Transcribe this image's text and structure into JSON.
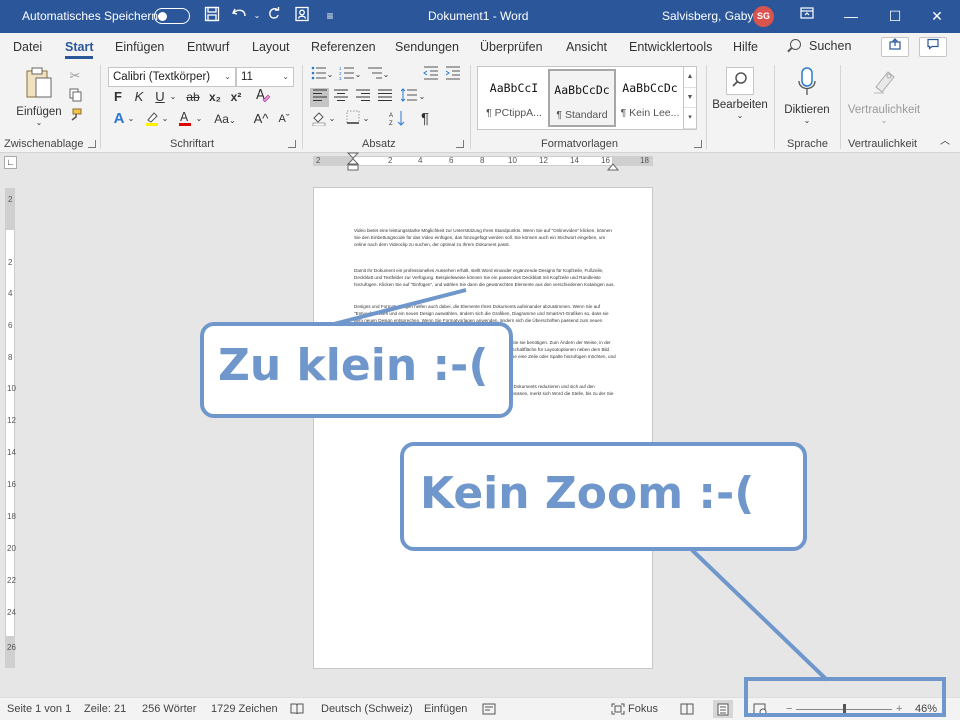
{
  "titlebar": {
    "autosave_label": "Automatisches Speichern",
    "doc_title": "Dokument1  -  Word",
    "user_name": "Salvisberg, Gaby",
    "user_initials": "SG"
  },
  "tabs": [
    "Datei",
    "Start",
    "Einfügen",
    "Entwurf",
    "Layout",
    "Referenzen",
    "Sendungen",
    "Überprüfen",
    "Ansicht",
    "Entwicklertools",
    "Hilfe"
  ],
  "active_tab": "Start",
  "search_label": "Suchen",
  "ribbon": {
    "clipboard": {
      "paste_label": "Einfügen",
      "group_label": "Zwischenablage"
    },
    "font": {
      "font_name": "Calibri (Textkörper)",
      "font_size": "11",
      "group_label": "Schriftart",
      "bold": "F",
      "italic": "K",
      "underline": "U",
      "strike": "ab",
      "sub": "x₂",
      "sup": "x²",
      "case": "Aa",
      "grow": "A^",
      "shrink": "Aˇ"
    },
    "paragraph": {
      "group_label": "Absatz"
    },
    "styles": {
      "group_label": "Formatvorlagen",
      "items": [
        {
          "sample": "AaBbCcI",
          "name": "¶ PCtippA..."
        },
        {
          "sample": "AaBbCcDc",
          "name": "¶ Standard"
        },
        {
          "sample": "AaBbCcDc",
          "name": "¶ Kein Lee..."
        }
      ]
    },
    "editing": {
      "label": "Bearbeiten"
    },
    "voice": {
      "label": "Diktieren",
      "group_label": "Sprache"
    },
    "sensitivity": {
      "label": "Vertraulichkeit",
      "group_label": "Vertraulichkeit"
    }
  },
  "ruler": {
    "h_ticks": [
      "2",
      "2",
      "4",
      "6",
      "8",
      "10",
      "12",
      "14",
      "16",
      "18"
    ],
    "v_ticks": [
      "2",
      "2",
      "4",
      "6",
      "8",
      "10",
      "12",
      "14",
      "16",
      "18",
      "20",
      "22",
      "24",
      "26"
    ]
  },
  "document": {
    "paragraphs": [
      "Video bietet eine leistungsstarke Möglichkeit zur Unterstützung Ihres Standpunkts. Wenn Sie auf \"Onlinevideo\" klicken, können Sie den Einbettungscode für das Video einfügen, das hinzugefügt werden soll. Sie können auch ein Stichwort eingeben, um online nach dem Videoclip zu suchen, der optimal zu Ihrem Dokument passt.",
      "Damit Ihr Dokument ein professionelles Aussehen erhält, stellt Word einander ergänzende Designs für Kopfzeile, Fußzeile, Deckblatt und Textfelder zur Verfügung. Beispielsweise können Sie ein passendes Deckblatt mit Kopfzeile und Randleiste hinzufügen. Klicken Sie auf \"Einfügen\", und wählen Sie dann die gewünschten Elemente aus den verschiedenen Katalogen aus.",
      "Designs und Formatvorlagen helfen auch dabei, die Elemente Ihres Dokuments aufeinander abzustimmen. Wenn Sie auf \"Entwurf\" klicken und ein neues Design auswählen, ändern sich die Grafiken, Diagramme und SmartArt-Grafiken so, dass sie dem neuen Design entsprechen. Wenn Sie Formatvorlagen anwenden, ändern sich die Überschriften passend zum neuen Design.",
      "Sparen Sie Zeit in Word dank neuer Schaltflächen, die angezeigt werden, wo Sie sie benötigen. Zum Ändern der Weise, in der sich ein Bild in Ihr Dokument einfügt, klicken Sie auf das Bild. Dann wird eine Schaltfläche für Layoutoptionen neben dem Bild angezeigt. Beim Arbeiten an einer Tabelle klicken Sie an die Position, an der Sie eine Zeile oder Spalte hinzufügen möchten, und klicken Sie dann auf das Pluszeichen.",
      "Auch das Lesen ist bequemer in der neuen Leseansicht. Sie können Teile des Dokuments reduzieren und sich auf den gewünschten Text konzentrieren. Wenn Sie vor dem Ende zu lesen aufhören müssen, merkt sich Word die Stelle, bis zu der Sie gelangt sind – sogar auf einem anderen Gerät."
    ]
  },
  "callouts": {
    "too_small": "Zu klein :-(",
    "no_zoom": "Kein Zoom :-("
  },
  "statusbar": {
    "page": "Seite 1 von 1",
    "line": "Zeile: 21",
    "words": "256 Wörter",
    "chars": "1729 Zeichen",
    "language": "Deutsch (Schweiz)",
    "mode": "Einfügen",
    "focus": "Fokus",
    "zoom_minus": "−",
    "zoom_plus": "+",
    "zoom": "46%"
  },
  "colors": {
    "title_bar": "#2b579a",
    "callout": "#6f97cc"
  }
}
